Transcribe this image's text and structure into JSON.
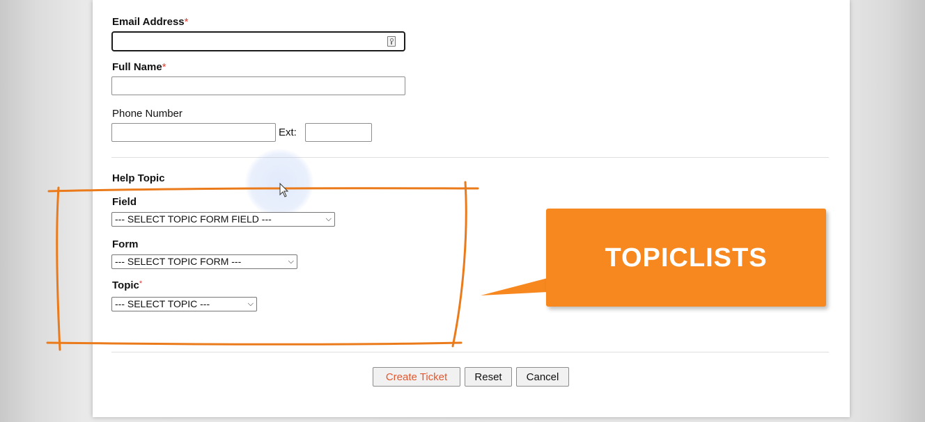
{
  "form": {
    "email": {
      "label": "Email Address",
      "required_mark": "*",
      "value": ""
    },
    "full_name": {
      "label": "Full Name",
      "required_mark": "*",
      "value": ""
    },
    "phone": {
      "label": "Phone Number",
      "value": "",
      "ext_label": "Ext:",
      "ext_value": ""
    },
    "help_topic": {
      "heading": "Help Topic",
      "field": {
        "label": "Field",
        "selected": "--- SELECT TOPIC FORM FIELD ---"
      },
      "form": {
        "label": "Form",
        "selected": "--- SELECT TOPIC FORM ---"
      },
      "topic": {
        "label": "Topic",
        "required_mark": "*",
        "selected": "--- SELECT TOPIC ---"
      }
    },
    "buttons": {
      "create": "Create Ticket",
      "reset": "Reset",
      "cancel": "Cancel"
    }
  },
  "annotation": {
    "callout_text": "TOPICLISTS",
    "color": "#f7881f",
    "outline_color": "#ea7a1a"
  },
  "icons": {
    "email_autofill": "contact-card-icon",
    "dropdown": "chevron-down-icon"
  }
}
